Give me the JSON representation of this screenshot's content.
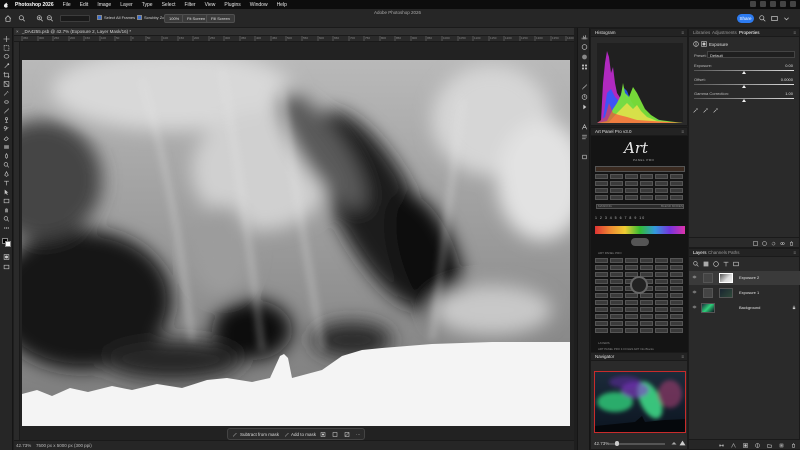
{
  "menubar": {
    "items": [
      "Photoshop 2026",
      "File",
      "Edit",
      "Image",
      "Layer",
      "Type",
      "Select",
      "Filter",
      "View",
      "Plugins",
      "Window",
      "Help"
    ]
  },
  "options_bar": {
    "checkbox_1": "Select All Frames",
    "checkbox_2": "Scrubby Zoom",
    "zoom_value": "100%",
    "btn_fit": "Fit Screen",
    "btn_fill": "Fill Screen",
    "share_label": "Share"
  },
  "window_title": "Adobe Photoshop 2026",
  "document": {
    "tab_label": "_DA4255.psb @ 42.7% (Exposure 2, Layer Mask/16) *",
    "close_glyph": "×",
    "ruler_ticks": [
      "350",
      "300",
      "250",
      "200",
      "150",
      "100",
      "50",
      "0",
      "50",
      "100",
      "150",
      "200",
      "250",
      "300",
      "350",
      "400",
      "450",
      "500",
      "550",
      "600",
      "650",
      "700",
      "750",
      "800",
      "850",
      "900",
      "950",
      "1000",
      "1050",
      "1100",
      "1150",
      "1200",
      "1250",
      "1300",
      "1350",
      "1400"
    ]
  },
  "taskbar": {
    "subtract": "Subtract from mask",
    "add": "Add to mask",
    "more": "···"
  },
  "status": {
    "zoom": "42.73%",
    "info": "7500 px x 5000 px (300 ppi)",
    "arrow": "›"
  },
  "histogram": {
    "title": "Histogram",
    "menu": "≡"
  },
  "art_panel": {
    "title": "Art Panel Pro v3.0",
    "menu": "≡",
    "logo_word": "Art",
    "logo_sub": "PANEL PRO",
    "label_a": "MASKING",
    "label_b": "BLEND MODES",
    "label_c": "ART PANEL PRO",
    "label_d": "LAYERS",
    "scale_numbers": "1 2 3 4 5 6 7 8 9 10",
    "footer_text": "ART PANEL PRO 3.0    FILES    ART    Info Blocks"
  },
  "navigator": {
    "title": "Navigator",
    "menu": "≡",
    "zoom": "42.73%"
  },
  "properties": {
    "tabs": [
      "Libraries",
      "Adjustments",
      "Properties"
    ],
    "active_tab": "Properties",
    "subheader": "Exposure",
    "preset_label": "Preset:",
    "preset_value": "Default",
    "rows": [
      {
        "label": "Exposure:",
        "value": "0.00",
        "knob": 0.5
      },
      {
        "label": "Offset:",
        "value": "0.0000",
        "knob": 0.5
      },
      {
        "label": "Gamma Correction:",
        "value": "1.00",
        "knob": 0.5
      }
    ]
  },
  "layers": {
    "tabs": [
      "Layers",
      "Channels",
      "Paths"
    ],
    "active_tab": "Layers",
    "items": [
      {
        "name": "Exposure 2",
        "selected": true,
        "thumb": "mask"
      },
      {
        "name": "Exposure 1",
        "selected": false,
        "thumb": "dark"
      },
      {
        "name": "Background",
        "selected": false,
        "thumb": "photo"
      }
    ]
  },
  "colors": {
    "accent": "#2d7bf0",
    "panel_bg": "#2a2a2a",
    "app_bg": "#1e1e1e",
    "aurora_green": "#2fd07a",
    "navigator_frame": "#c92b2b"
  }
}
